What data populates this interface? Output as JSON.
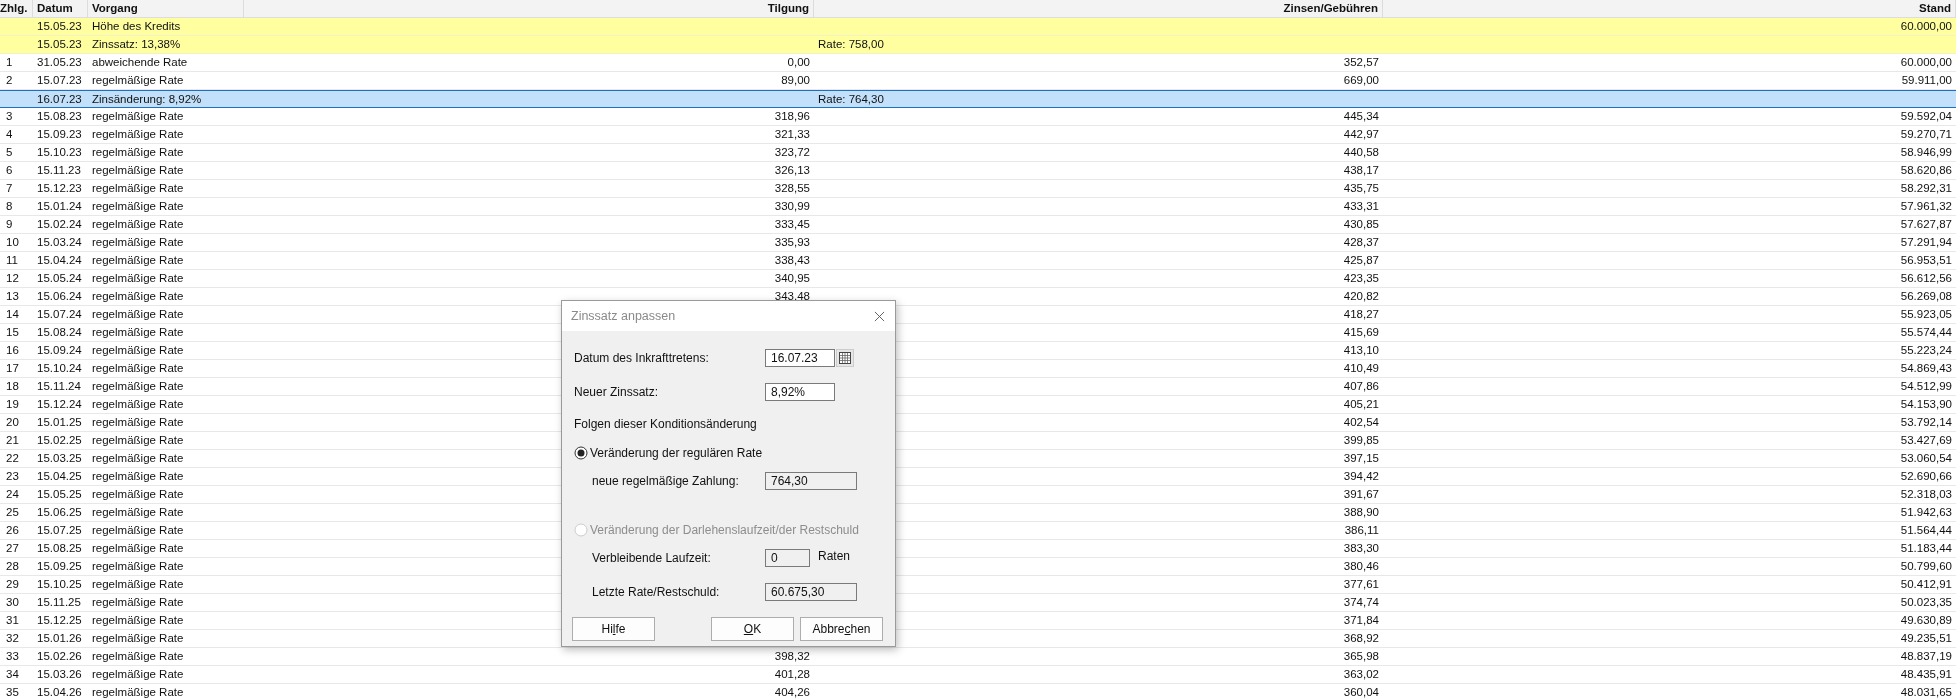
{
  "table": {
    "columns": [
      "Zhlg.",
      "Datum",
      "Vorgang",
      "Tilgung",
      "Zinsen/Gebühren",
      "Stand"
    ],
    "rows": [
      {
        "kind": "info",
        "selected": false,
        "date": "15.05.23",
        "text": "Höhe des Kredits",
        "stand": "60.000,00"
      },
      {
        "kind": "info",
        "selected": false,
        "date": "15.05.23",
        "text": "Zinssatz: 13,38%",
        "note": "Rate: 758,00"
      },
      {
        "kind": "payment",
        "selected": false,
        "no": "1",
        "date": "31.05.23",
        "text": "abweichende Rate",
        "tilgung": "0,00",
        "zinsen": "352,57",
        "stand": "60.000,00"
      },
      {
        "kind": "payment",
        "selected": false,
        "no": "2",
        "date": "15.07.23",
        "text": "regelmäßige Rate",
        "tilgung": "89,00",
        "zinsen": "669,00",
        "stand": "59.911,00"
      },
      {
        "kind": "change",
        "selected": true,
        "date": "16.07.23",
        "text": "Zinsänderung: 8,92%",
        "note": "Rate: 764,30"
      },
      {
        "kind": "payment",
        "selected": false,
        "no": "3",
        "date": "15.08.23",
        "text": "regelmäßige Rate",
        "tilgung": "318,96",
        "zinsen": "445,34",
        "stand": "59.592,04"
      },
      {
        "kind": "payment",
        "selected": false,
        "no": "4",
        "date": "15.09.23",
        "text": "regelmäßige Rate",
        "tilgung": "321,33",
        "zinsen": "442,97",
        "stand": "59.270,71"
      },
      {
        "kind": "payment",
        "selected": false,
        "no": "5",
        "date": "15.10.23",
        "text": "regelmäßige Rate",
        "tilgung": "323,72",
        "zinsen": "440,58",
        "stand": "58.946,99"
      },
      {
        "kind": "payment",
        "selected": false,
        "no": "6",
        "date": "15.11.23",
        "text": "regelmäßige Rate",
        "tilgung": "326,13",
        "zinsen": "438,17",
        "stand": "58.620,86"
      },
      {
        "kind": "payment",
        "selected": false,
        "no": "7",
        "date": "15.12.23",
        "text": "regelmäßige Rate",
        "tilgung": "328,55",
        "zinsen": "435,75",
        "stand": "58.292,31"
      },
      {
        "kind": "payment",
        "selected": false,
        "no": "8",
        "date": "15.01.24",
        "text": "regelmäßige Rate",
        "tilgung": "330,99",
        "zinsen": "433,31",
        "stand": "57.961,32"
      },
      {
        "kind": "payment",
        "selected": false,
        "no": "9",
        "date": "15.02.24",
        "text": "regelmäßige Rate",
        "tilgung": "333,45",
        "zinsen": "430,85",
        "stand": "57.627,87"
      },
      {
        "kind": "payment",
        "selected": false,
        "no": "10",
        "date": "15.03.24",
        "text": "regelmäßige Rate",
        "tilgung": "335,93",
        "zinsen": "428,37",
        "stand": "57.291,94"
      },
      {
        "kind": "payment",
        "selected": false,
        "no": "11",
        "date": "15.04.24",
        "text": "regelmäßige Rate",
        "tilgung": "338,43",
        "zinsen": "425,87",
        "stand": "56.953,51"
      },
      {
        "kind": "payment",
        "selected": false,
        "no": "12",
        "date": "15.05.24",
        "text": "regelmäßige Rate",
        "tilgung": "340,95",
        "zinsen": "423,35",
        "stand": "56.612,56"
      },
      {
        "kind": "payment",
        "selected": false,
        "no": "13",
        "date": "15.06.24",
        "text": "regelmäßige Rate",
        "tilgung": "343,48",
        "zinsen": "420,82",
        "stand": "56.269,08"
      },
      {
        "kind": "payment",
        "selected": false,
        "no": "14",
        "date": "15.07.24",
        "text": "regelmäßige Rate",
        "zinsen": "418,27",
        "stand": "55.923,05"
      },
      {
        "kind": "payment",
        "selected": false,
        "no": "15",
        "date": "15.08.24",
        "text": "regelmäßige Rate",
        "zinsen": "415,69",
        "stand": "55.574,44"
      },
      {
        "kind": "payment",
        "selected": false,
        "no": "16",
        "date": "15.09.24",
        "text": "regelmäßige Rate",
        "zinsen": "413,10",
        "stand": "55.223,24"
      },
      {
        "kind": "payment",
        "selected": false,
        "no": "17",
        "date": "15.10.24",
        "text": "regelmäßige Rate",
        "zinsen": "410,49",
        "stand": "54.869,43"
      },
      {
        "kind": "payment",
        "selected": false,
        "no": "18",
        "date": "15.11.24",
        "text": "regelmäßige Rate",
        "zinsen": "407,86",
        "stand": "54.512,99"
      },
      {
        "kind": "payment",
        "selected": false,
        "no": "19",
        "date": "15.12.24",
        "text": "regelmäßige Rate",
        "zinsen": "405,21",
        "stand": "54.153,90"
      },
      {
        "kind": "payment",
        "selected": false,
        "no": "20",
        "date": "15.01.25",
        "text": "regelmäßige Rate",
        "zinsen": "402,54",
        "stand": "53.792,14"
      },
      {
        "kind": "payment",
        "selected": false,
        "no": "21",
        "date": "15.02.25",
        "text": "regelmäßige Rate",
        "zinsen": "399,85",
        "stand": "53.427,69"
      },
      {
        "kind": "payment",
        "selected": false,
        "no": "22",
        "date": "15.03.25",
        "text": "regelmäßige Rate",
        "zinsen": "397,15",
        "stand": "53.060,54"
      },
      {
        "kind": "payment",
        "selected": false,
        "no": "23",
        "date": "15.04.25",
        "text": "regelmäßige Rate",
        "zinsen": "394,42",
        "stand": "52.690,66"
      },
      {
        "kind": "payment",
        "selected": false,
        "no": "24",
        "date": "15.05.25",
        "text": "regelmäßige Rate",
        "zinsen": "391,67",
        "stand": "52.318,03"
      },
      {
        "kind": "payment",
        "selected": false,
        "no": "25",
        "date": "15.06.25",
        "text": "regelmäßige Rate",
        "zinsen": "388,90",
        "stand": "51.942,63"
      },
      {
        "kind": "payment",
        "selected": false,
        "no": "26",
        "date": "15.07.25",
        "text": "regelmäßige Rate",
        "zinsen": "386,11",
        "stand": "51.564,44"
      },
      {
        "kind": "payment",
        "selected": false,
        "no": "27",
        "date": "15.08.25",
        "text": "regelmäßige Rate",
        "zinsen": "383,30",
        "stand": "51.183,44"
      },
      {
        "kind": "payment",
        "selected": false,
        "no": "28",
        "date": "15.09.25",
        "text": "regelmäßige Rate",
        "zinsen": "380,46",
        "stand": "50.799,60"
      },
      {
        "kind": "payment",
        "selected": false,
        "no": "29",
        "date": "15.10.25",
        "text": "regelmäßige Rate",
        "zinsen": "377,61",
        "stand": "50.412,91"
      },
      {
        "kind": "payment",
        "selected": false,
        "no": "30",
        "date": "15.11.25",
        "text": "regelmäßige Rate",
        "zinsen": "374,74",
        "stand": "50.023,35"
      },
      {
        "kind": "payment",
        "selected": false,
        "no": "31",
        "date": "15.12.25",
        "text": "regelmäßige Rate",
        "zinsen": "371,84",
        "stand": "49.630,89"
      },
      {
        "kind": "payment",
        "selected": false,
        "no": "32",
        "date": "15.01.26",
        "text": "regelmäßige Rate",
        "zinsen": "368,92",
        "stand": "49.235,51"
      },
      {
        "kind": "payment",
        "selected": false,
        "no": "33",
        "date": "15.02.26",
        "text": "regelmäßige Rate",
        "tilgung": "398,32",
        "zinsen": "365,98",
        "stand": "48.837,19"
      },
      {
        "kind": "payment",
        "selected": false,
        "no": "34",
        "date": "15.03.26",
        "text": "regelmäßige Rate",
        "tilgung": "401,28",
        "zinsen": "363,02",
        "stand": "48.435,91"
      },
      {
        "kind": "payment",
        "selected": false,
        "no": "35",
        "date": "15.04.26",
        "text": "regelmäßige Rate",
        "tilgung": "404,26",
        "zinsen": "360,04",
        "stand": "48.031,65"
      }
    ]
  },
  "dialog": {
    "title": "Zinssatz anpassen",
    "date_field": {
      "label": "Datum des Inkrafttretens:",
      "value": "16.07.23"
    },
    "rate_field": {
      "label": "Neuer Zinssatz:",
      "value": "8,92%"
    },
    "section_label": "Folgen dieser Konditionsänderung",
    "options": [
      {
        "label": "Veränderung der regulären Rate",
        "selected": true,
        "disabled": false,
        "fields": [
          {
            "label": "neue regelmäßige Zahlung:",
            "value": "764,30",
            "short": false
          }
        ]
      },
      {
        "label": "Veränderung der Darlehenslaufzeit/der Restschuld",
        "selected": false,
        "disabled": true,
        "fields": [
          {
            "label": "Verbleibende Laufzeit:",
            "value": "0",
            "suffix": "Raten",
            "short": true
          },
          {
            "label": "Letzte Rate/Restschuld:",
            "value": "60.675,30",
            "short": false
          }
        ]
      }
    ],
    "buttons": [
      {
        "before": "Hi",
        "key": "l",
        "after": "fe"
      },
      {
        "key": "O",
        "after": "K"
      },
      {
        "before": "Abbre",
        "key": "c",
        "after": "hen"
      }
    ]
  }
}
